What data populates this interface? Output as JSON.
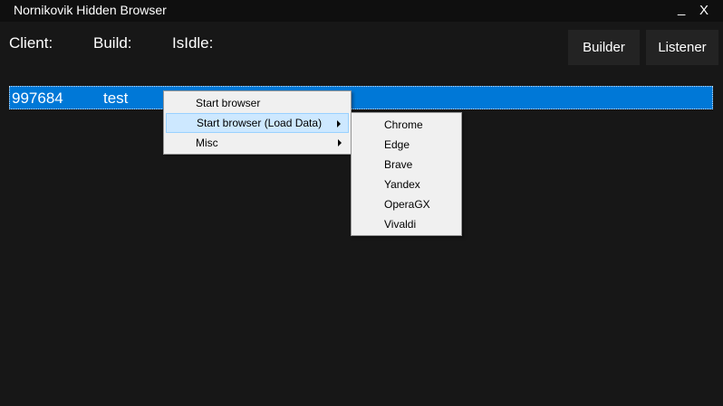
{
  "window": {
    "title": "Nornikovik Hidden Browser",
    "minimize_label": "_",
    "close_label": "X"
  },
  "info": {
    "client_label": "Client:",
    "build_label": "Build:",
    "isidle_label": "IsIdle:"
  },
  "toolbar": {
    "builder_label": "Builder",
    "listener_label": "Listener"
  },
  "clients": {
    "rows": [
      {
        "id": "997684",
        "name": "test",
        "selected": true
      }
    ]
  },
  "context_menu": {
    "items": [
      {
        "label": "Start browser",
        "has_submenu": false
      },
      {
        "label": "Start browser (Load Data)",
        "has_submenu": true,
        "highlighted": true
      },
      {
        "label": "Misc",
        "has_submenu": true
      }
    ]
  },
  "submenu": {
    "items": [
      {
        "label": "Chrome"
      },
      {
        "label": "Edge"
      },
      {
        "label": "Brave"
      },
      {
        "label": "Yandex"
      },
      {
        "label": "OperaGX"
      },
      {
        "label": "Vivaldi"
      }
    ]
  },
  "colors": {
    "background": "#171717",
    "titlebar": "#0f0f0f",
    "selection": "#0078d7",
    "menu_bg": "#f0f0f0",
    "menu_highlight": "#cde8ff"
  }
}
